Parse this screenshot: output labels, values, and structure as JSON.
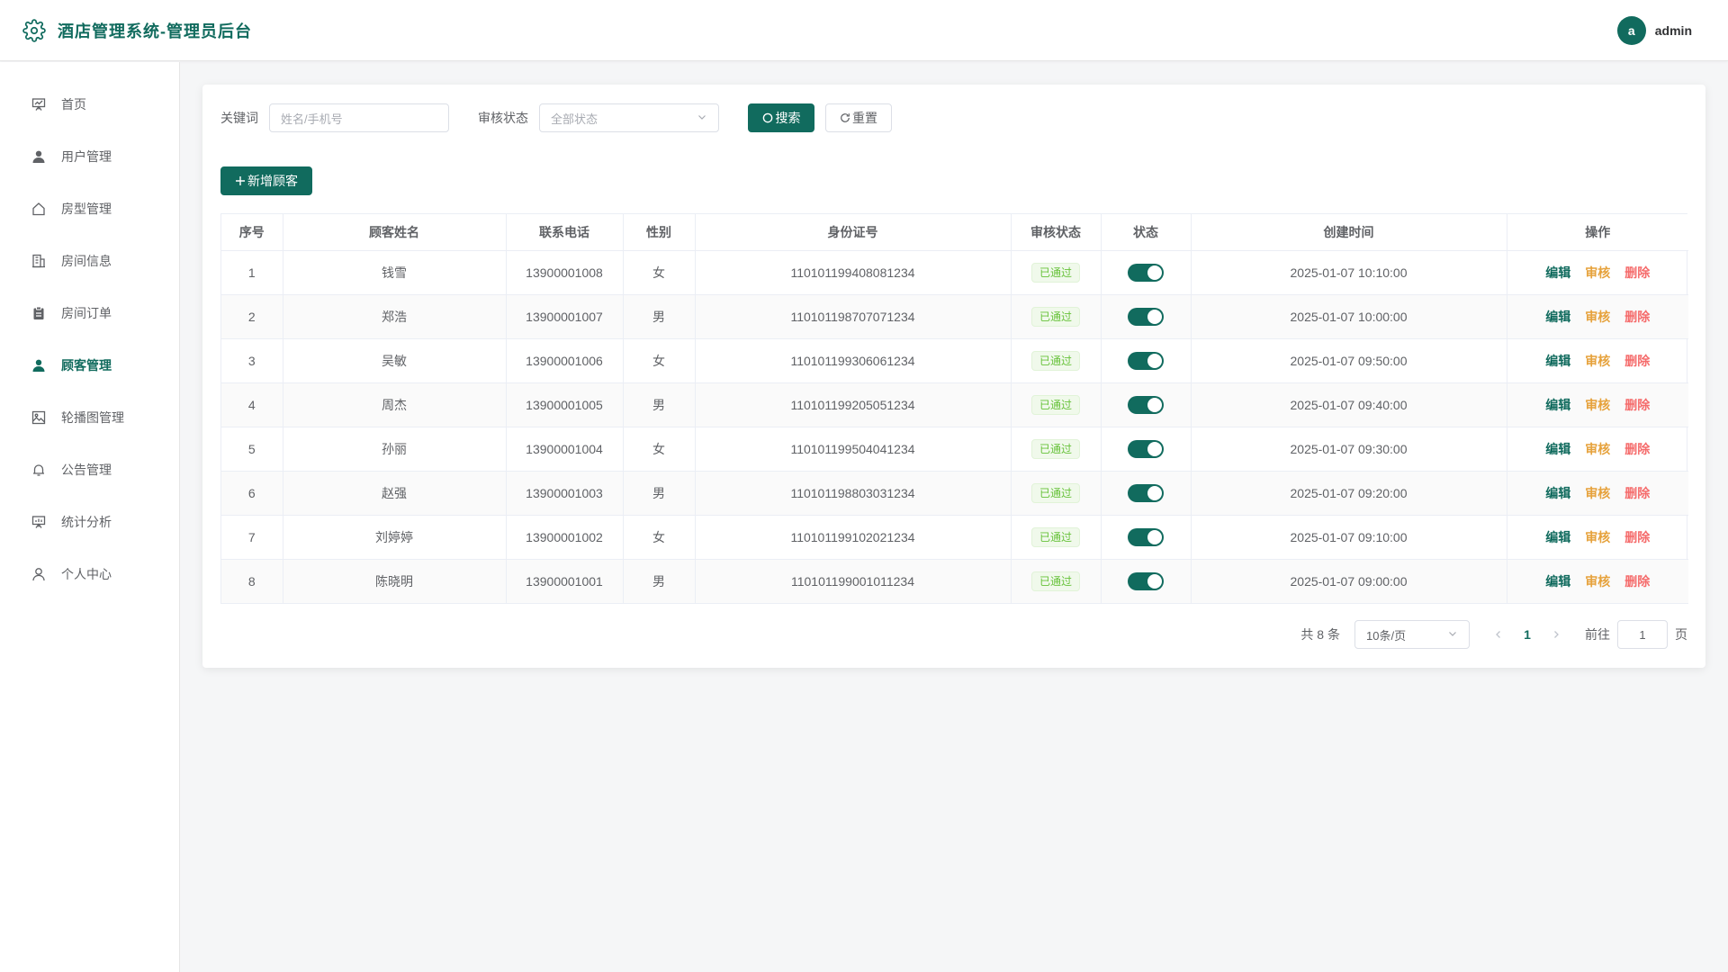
{
  "header": {
    "title": "酒店管理系统-管理员后台",
    "avatar_letter": "a",
    "username": "admin",
    "logo_icon": "gear-icon",
    "brand_color": "#116b5e"
  },
  "sidebar": {
    "items": [
      {
        "label": "首页",
        "icon": "presentation-icon",
        "active": false
      },
      {
        "label": "用户管理",
        "icon": "user-icon",
        "active": false
      },
      {
        "label": "房型管理",
        "icon": "house-icon",
        "active": false
      },
      {
        "label": "房间信息",
        "icon": "building-icon",
        "active": false
      },
      {
        "label": "房间订单",
        "icon": "clipboard-icon",
        "active": false
      },
      {
        "label": "顾客管理",
        "icon": "user-icon",
        "active": true
      },
      {
        "label": "轮播图管理",
        "icon": "picture-icon",
        "active": false
      },
      {
        "label": "公告管理",
        "icon": "bell-icon",
        "active": false
      },
      {
        "label": "统计分析",
        "icon": "chart-board-icon",
        "active": false
      },
      {
        "label": "个人中心",
        "icon": "user-outline-icon",
        "active": false
      }
    ]
  },
  "filters": {
    "keyword_label": "关键词",
    "keyword_placeholder": "姓名/手机号",
    "status_label": "审核状态",
    "status_placeholder": "全部状态",
    "search_label": "搜索",
    "reset_label": "重置"
  },
  "actions": {
    "add_label": "新增顾客"
  },
  "table": {
    "columns": [
      "序号",
      "顾客姓名",
      "联系电话",
      "性别",
      "身份证号",
      "审核状态",
      "状态",
      "创建时间",
      "操作"
    ],
    "op_labels": {
      "edit": "编辑",
      "audit": "审核",
      "delete": "删除"
    },
    "rows": [
      {
        "no": "1",
        "name": "钱雪",
        "phone": "13900001008",
        "gender": "女",
        "id_card": "110101199408081234",
        "audit": "已通过",
        "enabled": true,
        "created": "2025-01-07 10:10:00"
      },
      {
        "no": "2",
        "name": "郑浩",
        "phone": "13900001007",
        "gender": "男",
        "id_card": "110101198707071234",
        "audit": "已通过",
        "enabled": true,
        "created": "2025-01-07 10:00:00"
      },
      {
        "no": "3",
        "name": "吴敏",
        "phone": "13900001006",
        "gender": "女",
        "id_card": "110101199306061234",
        "audit": "已通过",
        "enabled": true,
        "created": "2025-01-07 09:50:00"
      },
      {
        "no": "4",
        "name": "周杰",
        "phone": "13900001005",
        "gender": "男",
        "id_card": "110101199205051234",
        "audit": "已通过",
        "enabled": true,
        "created": "2025-01-07 09:40:00"
      },
      {
        "no": "5",
        "name": "孙丽",
        "phone": "13900001004",
        "gender": "女",
        "id_card": "110101199504041234",
        "audit": "已通过",
        "enabled": true,
        "created": "2025-01-07 09:30:00"
      },
      {
        "no": "6",
        "name": "赵强",
        "phone": "13900001003",
        "gender": "男",
        "id_card": "110101198803031234",
        "audit": "已通过",
        "enabled": true,
        "created": "2025-01-07 09:20:00"
      },
      {
        "no": "7",
        "name": "刘婷婷",
        "phone": "13900001002",
        "gender": "女",
        "id_card": "110101199102021234",
        "audit": "已通过",
        "enabled": true,
        "created": "2025-01-07 09:10:00"
      },
      {
        "no": "8",
        "name": "陈晓明",
        "phone": "13900001001",
        "gender": "男",
        "id_card": "110101199001011234",
        "audit": "已通过",
        "enabled": true,
        "created": "2025-01-07 09:00:00"
      }
    ]
  },
  "pagination": {
    "total_text": "共 8 条",
    "page_size": "10条/页",
    "current_page": "1",
    "goto_label": "前往",
    "goto_value": "1",
    "page_suffix": "页"
  }
}
